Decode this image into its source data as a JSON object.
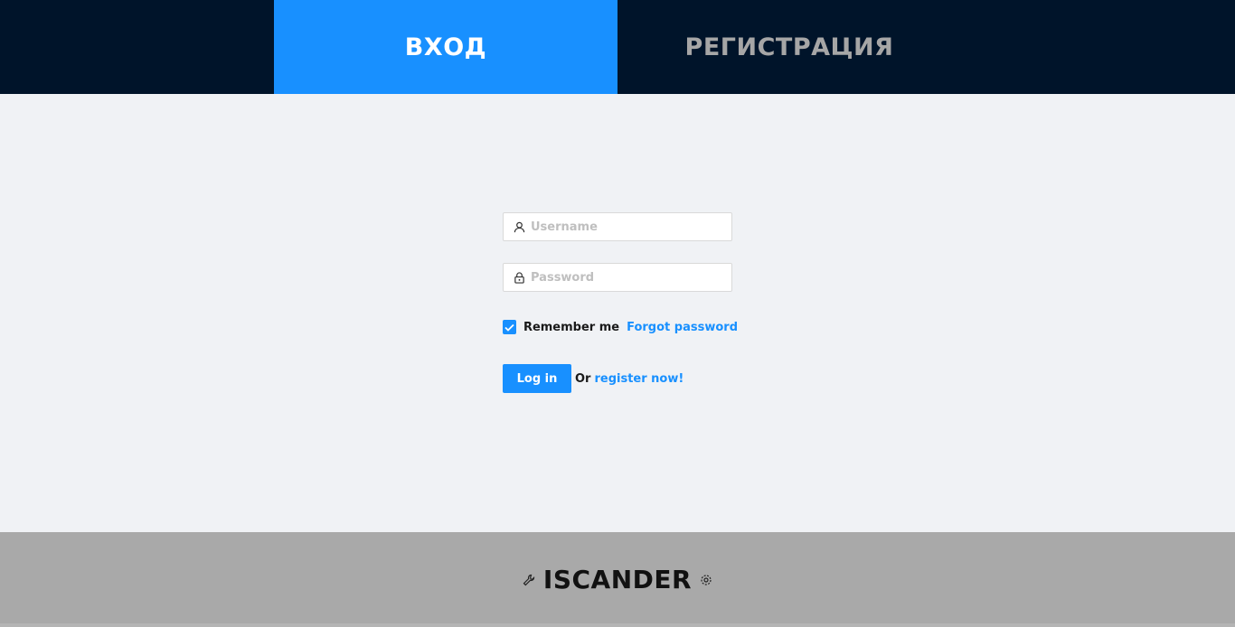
{
  "tabs": {
    "login": "ВХОД",
    "register": "РЕГИСТРАЦИЯ"
  },
  "form": {
    "username_placeholder": "Username",
    "password_placeholder": "Password",
    "remember_label": "Remember me",
    "remember_checked": true,
    "forgot_label": "Forgot password",
    "login_button": "Log in",
    "or_text": "Or",
    "register_link": "register now!"
  },
  "footer": {
    "brand": "ISCANDER"
  },
  "colors": {
    "primary": "#1890ff",
    "topbar": "#00142a",
    "background": "#f0f2f5",
    "footer": "#a9a9a9"
  },
  "icons": [
    "user-icon",
    "lock-icon",
    "check-icon",
    "wrench-icon",
    "gear-icon"
  ]
}
